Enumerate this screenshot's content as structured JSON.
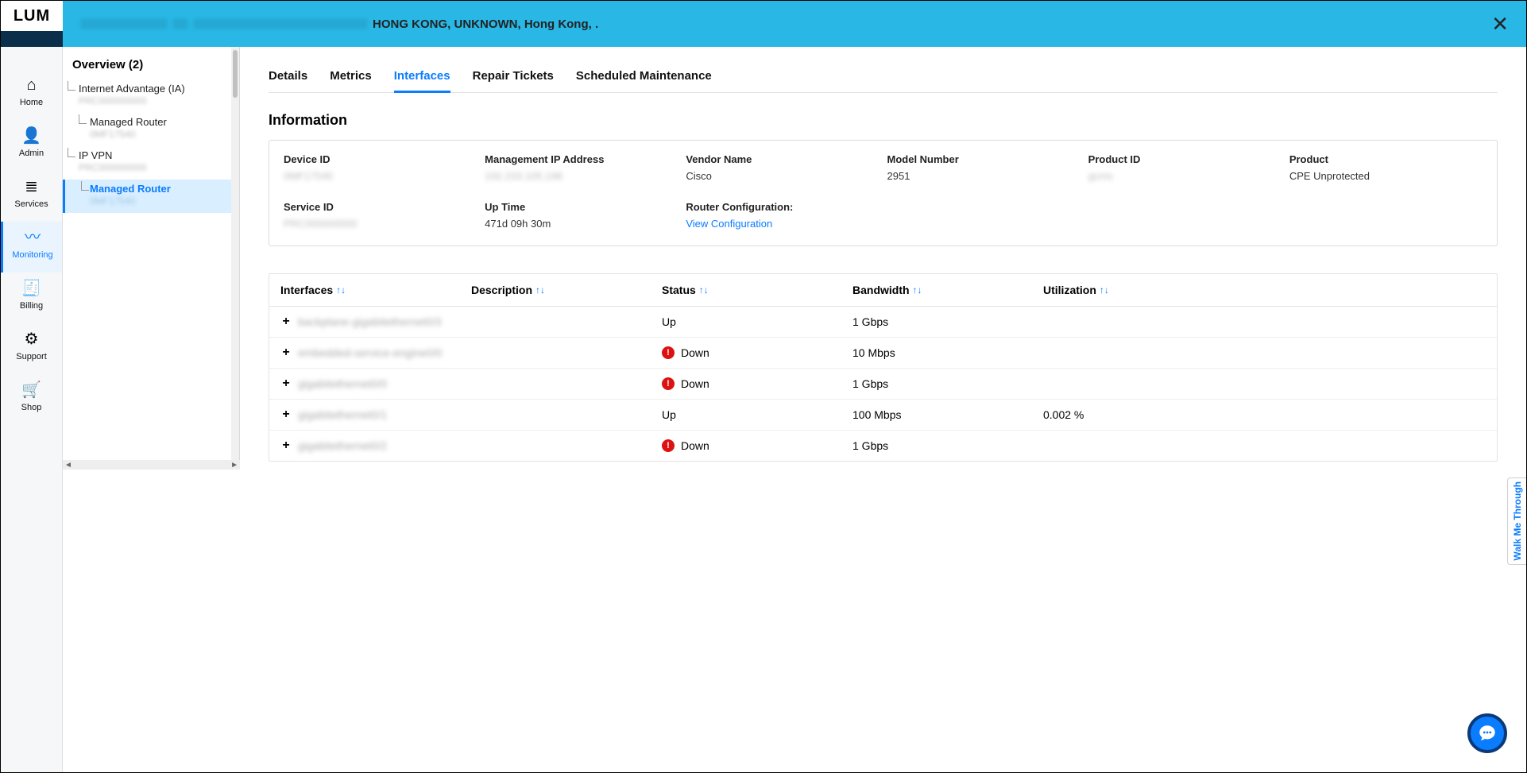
{
  "brand": "LUM",
  "topbar": {
    "location": "HONG KONG, UNKNOWN, Hong Kong, ."
  },
  "leftnav": [
    {
      "id": "home",
      "label": "Home"
    },
    {
      "id": "admin",
      "label": "Admin"
    },
    {
      "id": "services",
      "label": "Services"
    },
    {
      "id": "monitoring",
      "label": "Monitoring"
    },
    {
      "id": "billing",
      "label": "Billing"
    },
    {
      "id": "support",
      "label": "Support"
    },
    {
      "id": "shop",
      "label": "Shop"
    }
  ],
  "tree": {
    "title": "Overview (2)",
    "nodes": [
      {
        "name": "Internet Advantage (IA)",
        "sub": "PRC000000000"
      },
      {
        "name": "Managed Router",
        "sub": "0MF17540",
        "child": true
      },
      {
        "name": "IP VPN",
        "sub": "PRC000000000"
      },
      {
        "name": "Managed Router",
        "sub": "0MF17540",
        "child": true,
        "selected": true
      }
    ]
  },
  "tabs": [
    "Details",
    "Metrics",
    "Interfaces",
    "Repair Tickets",
    "Scheduled Maintenance"
  ],
  "activeTab": "Interfaces",
  "section_title": "Information",
  "info": {
    "device_id": {
      "k": "Device ID",
      "v": "0MF17540",
      "blur": true
    },
    "mgmt_ip": {
      "k": "Management IP Address",
      "v": "192.233.105.198",
      "blur": true
    },
    "vendor": {
      "k": "Vendor Name",
      "v": "Cisco"
    },
    "model": {
      "k": "Model Number",
      "v": "2951"
    },
    "product_id": {
      "k": "Product ID",
      "v": "gcms",
      "blur": true
    },
    "product": {
      "k": "Product",
      "v": "CPE Unprotected"
    },
    "service_id": {
      "k": "Service ID",
      "v": "PRC000000000",
      "blur": true
    },
    "uptime": {
      "k": "Up Time",
      "v": "471d 09h 30m"
    },
    "router_cfg": {
      "k": "Router Configuration:",
      "v": "View Configuration",
      "link": true
    }
  },
  "table": {
    "headers": [
      "Interfaces",
      "Description",
      "Status",
      "Bandwidth",
      "Utilization"
    ],
    "rows": [
      {
        "name": "backplane-gigabitethernet0/3",
        "desc": "",
        "status": "Up",
        "bw": "1 Gbps",
        "util": ""
      },
      {
        "name": "embedded-service-engine0/0",
        "desc": "",
        "status": "Down",
        "bw": "10 Mbps",
        "util": ""
      },
      {
        "name": "gigabitethernet0/0",
        "desc": "",
        "status": "Down",
        "bw": "1 Gbps",
        "util": ""
      },
      {
        "name": "gigabitethernet0/1",
        "desc": "",
        "status": "Up",
        "bw": "100 Mbps",
        "util": "0.002 %"
      },
      {
        "name": "gigabitethernet0/2",
        "desc": "",
        "status": "Down",
        "bw": "1 Gbps",
        "util": ""
      }
    ]
  },
  "walkme_label": "Walk Me Through"
}
